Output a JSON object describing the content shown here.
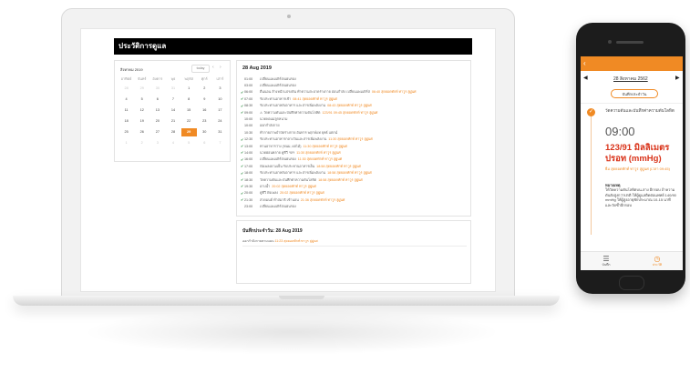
{
  "laptop": {
    "header_title": "ประวัติการดูแล",
    "calendar": {
      "month_label": "สิงหาคม 2019",
      "today_label": "today",
      "prev_icon": "‹",
      "next_icon": "›",
      "weekdays": [
        "อาทิตย์",
        "จันทร์",
        "อังคาร",
        "พุธ",
        "พฤหัส",
        "ศุกร์",
        "เสาร์"
      ],
      "weeks": [
        [
          "28",
          "29",
          "30",
          "31",
          "1",
          "2",
          "3"
        ],
        [
          "4",
          "5",
          "6",
          "7",
          "8",
          "9",
          "10"
        ],
        [
          "11",
          "12",
          "13",
          "14",
          "15",
          "16",
          "17"
        ],
        [
          "18",
          "19",
          "20",
          "21",
          "22",
          "23",
          "24"
        ],
        [
          "25",
          "26",
          "27",
          "28",
          "29",
          "30",
          "31"
        ],
        [
          "1",
          "2",
          "3",
          "4",
          "5",
          "6",
          "7"
        ]
      ],
      "selected_day": "29"
    },
    "timeline": {
      "date_title": "28 Aug 2019",
      "rows": [
        {
          "done": false,
          "time": "01:00",
          "text": "เปลี่ยนแพมเพิร์ส/แผ่นรอง",
          "note": "",
          "warn": false
        },
        {
          "done": false,
          "time": "03:00",
          "text": "เปลี่ยนแพมเพิร์ส/แผ่นรอง",
          "note": "",
          "warn": false
        },
        {
          "done": true,
          "time": "06:00",
          "text": "ตื่นนอน ล้างหน้าแปรงฟัน ทำความสะอาดร่างกาย อ่อนกำลัง เปลี่ยนแพมเพิร์ส",
          "note": "06:40 สุดยอดทักท์ ทาวูร ลู่ผูุ่นศ",
          "warn": false
        },
        {
          "done": true,
          "time": "07:00",
          "text": "รับประทานอาหารเช้า",
          "note": "08:41 สุดยอดทักท์ ทาวูร ลู่ผูุ่นศ",
          "warn": false
        },
        {
          "done": true,
          "time": "08:30",
          "text": "รับประทานยาหลังอาหาร และสารเพิ่มพลังงาน",
          "note": "08:43 สุดยอดทักท์ ทาวูร ลู่ผูุ่นศ",
          "warn": false
        },
        {
          "done": true,
          "time": "09:00",
          "text": "วัดความดันและบันทึกค่าความดันโลหิต",
          "note": "123/91 09:45 สุดยอดทักท์ ทาวูร ลู่ผูุ่นศ",
          "warn": true
        },
        {
          "done": false,
          "time": "10:00",
          "text": "นวดพ่อแม่ลูกหนาม",
          "note": "",
          "warn": false
        },
        {
          "done": false,
          "time": "10:00",
          "text": "ออกกำลังกาย",
          "note": "",
          "warn": false
        },
        {
          "done": false,
          "time": "10:30",
          "text": "ทำกายภาพบำบัดร่างกาย อันทาร พฤกษ์แท ยุทธ์ แตกน์",
          "note": "",
          "warn": false
        },
        {
          "done": true,
          "time": "12:30",
          "text": "รับประทานอาหารกลางวันและสารเพิ่มพลังงาน",
          "note": "11:30 สุดยอดทักท์ ทาวูร ลู่ผูุ่นศ",
          "warn": false
        },
        {
          "done": true,
          "time": "13:00",
          "text": "ทานอาหารว่าง (ขนม, ผลไม้)",
          "note": "11:30 สุดยอดทักท์ ทาวูร ลู่ผูุ่นศ",
          "warn": false
        },
        {
          "done": true,
          "time": "14:00",
          "text": "นวดผ่อนคลาย ดูทีวี ฯลฯ",
          "note": "11:30 สุดยอดทักท์ ทาวูร ลู่ผูุ่นศ",
          "warn": false
        },
        {
          "done": true,
          "time": "16:00",
          "text": "เปลี่ยนแพมเพิร์ส/แผ่นรอง",
          "note": "11:30 สุดยอดทักท์ ทาวูร ลู่ผูุ่นศ",
          "warn": false
        },
        {
          "done": true,
          "time": "17:00",
          "text": "ฟังเพลงยามเย็น รับประทานอาหารเย็น",
          "note": "18:58 สุดยอดทักท์ ทาวูร ลู่ผูุ่นศ",
          "warn": false
        },
        {
          "done": true,
          "time": "18:00",
          "text": "รับประทานยาหลังอาหาร และสารเพิ่มพลังงาน",
          "note": "18:58 สุดยอดทักท์ ทาวูร ลู่ผูุ่นศ",
          "warn": false
        },
        {
          "done": true,
          "time": "18:30",
          "text": "วัดความดันและบันทึกค่าความดันโลหิต",
          "note": "18:58 สุดยอดทักท์ ทาวูร ลู่ผูุ่นศ",
          "warn": false
        },
        {
          "done": true,
          "time": "19:30",
          "text": "อาบน้ำ",
          "note": "20:02 สุดยอดทักท์ ทาวูร ลู่ผูุ่นศ",
          "warn": false
        },
        {
          "done": true,
          "time": "20:00",
          "text": "ดูทีวี ฟังเพลง",
          "note": "20:02 สุดยอดทักท์ ทาวูร ลู่ผูุ่นศ",
          "warn": false
        },
        {
          "done": true,
          "time": "21:30",
          "text": "สวดมนต์ ทำสมาธิ เข้านอน",
          "note": "21:36 สุดยอดทักท์ ทาวูร ลู่ผูุ่นศ",
          "warn": false
        },
        {
          "done": false,
          "time": "23:00",
          "text": "เปลี่ยนแพมเพิร์ส/แผ่นรอง",
          "note": "",
          "warn": false
        }
      ]
    },
    "notes": {
      "title": "บันทึกประจำวัน: 28 Aug 2019",
      "line_text": "ออกกำลังกายตามแผน",
      "line_note": "11:23 สุดยอดทักท์ ทาวูร ลู่ผูุ่นศ"
    }
  },
  "phone": {
    "back_icon": "‹",
    "date": "28 สิงหาคม 2562",
    "prev_icon": "◀",
    "next_icon": "▶",
    "button_label": "บันทึกประจำวัน",
    "check_icon": "✓",
    "task": "วัดความดันและบันทึกค่าความดันโลหิต",
    "time": "09:00",
    "value": "123/91 มิลลิเมตรปรอท (mmHg)",
    "sub": "ยืม สุดยอดทักท์ ทาวูร ลู่ผูุ่นศ (เวลา 09:45)",
    "note_heading": "หมายเหตุ",
    "note": "ให้วัดความดันโลหิตบน-ล่าง อีกรอบ ถ้าความดันยังสูงกว่าปกติ ให้ผู้ดูแลติดต่อแพทย์ 140/90 mmHg ให้ผู้สูงอายุพักประมาณ 10-15 นาที และวัดซ้ำอีกรอบ",
    "tabs": [
      {
        "icon": "☰",
        "label": "บันทึก"
      },
      {
        "icon": "◷",
        "label": "ประวัติ"
      }
    ],
    "accent": "#f08a24"
  }
}
